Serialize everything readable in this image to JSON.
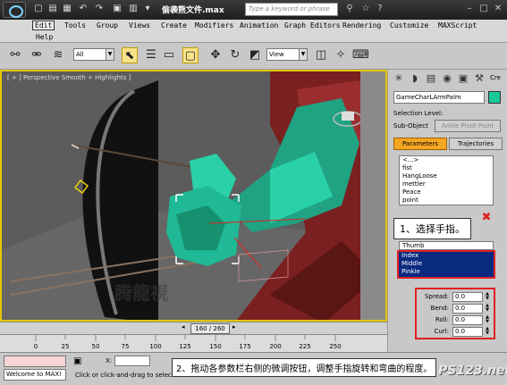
{
  "window": {
    "title": "偷袭熊文件.max",
    "search_placeholder": "Type a keyword or phrase"
  },
  "menu": [
    "Edit",
    "Tools",
    "Group",
    "Views",
    "Create",
    "Modifiers",
    "Animation",
    "Graph Editors",
    "Rendering",
    "Customize",
    "MAXScript",
    "Help"
  ],
  "toolbar": {
    "selection_filter": "All",
    "ref_coord": "View"
  },
  "viewport": {
    "label": "[ + ] Perspective  Smooth + Highlights ]",
    "callout_1": "1、选择手指。",
    "callout_2": "2、拖动各参数栏右侧的微调按钮，调整手指旋转和弯曲的程度。",
    "watermark": "腾龍視"
  },
  "panel": {
    "object_name": "GameCharLArmPalm",
    "selection_level_label": "Selection Level:",
    "sub_object_label": "Sub-Object",
    "sub_object_value": "Ankle Pivot Point",
    "tab_parameters": "Parameters",
    "tab_trajectories": "Trajectories",
    "pose_list": [
      "<...>",
      "fist",
      "HangLoose",
      "mettler",
      "Peace",
      "point"
    ],
    "finger_list_header": "Thumb",
    "finger_list_selected": [
      "Index",
      "Middle",
      "Pinkie"
    ],
    "spinners": [
      {
        "label": "Spread:",
        "value": "0.0"
      },
      {
        "label": "Bend:",
        "value": "0.0"
      },
      {
        "label": "Roll:",
        "value": "0.0"
      },
      {
        "label": "Curl:",
        "value": "0.0"
      }
    ],
    "prefix": "Cre"
  },
  "timeline": {
    "frame_display": "160 / 260",
    "ticks": [
      "0",
      "50",
      "100",
      "150",
      "200",
      "250"
    ],
    "ticks_minor": [
      "25",
      "75",
      "125",
      "175",
      "225"
    ]
  },
  "status": {
    "listener": "Welcome to MAX!",
    "prompt": "Click or click-and-drag to select",
    "x_label": "X:"
  },
  "brand_watermark": "PS123.net"
}
